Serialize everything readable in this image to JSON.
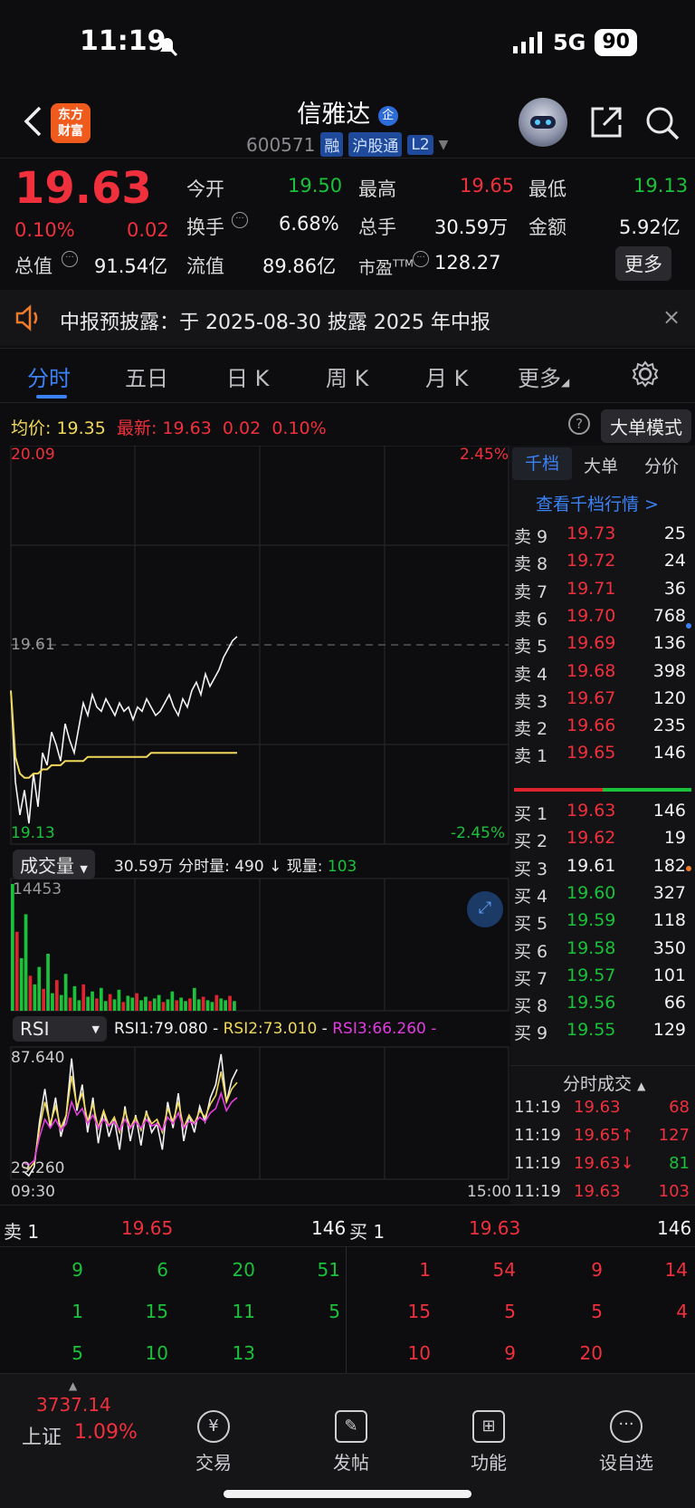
{
  "status": {
    "time": "11:19",
    "signal": "5G",
    "battery": "90"
  },
  "header": {
    "logo": [
      "东方",
      "财富"
    ],
    "name": "信雅达",
    "badge": "企",
    "code": "600571",
    "tags": [
      "融",
      "沪股通",
      "L2"
    ]
  },
  "quote": {
    "price": "19.63",
    "pct": "0.10%",
    "chg": "0.02",
    "open_label": "今开",
    "open": "19.50",
    "high_label": "最高",
    "high": "19.65",
    "low_label": "最低",
    "low": "19.13",
    "turnover_label": "换手",
    "turnover": "6.68%",
    "volume_label": "总手",
    "volume": "30.59万",
    "amount_label": "金额",
    "amount": "5.92亿",
    "mktcap_label": "总值",
    "mktcap": "91.54亿",
    "float_label": "流值",
    "float": "89.86亿",
    "pe_label": "市盈",
    "pe_sup": "TTM",
    "pe": "128.27",
    "more": "更多"
  },
  "notice": {
    "text": "中报预披露：于 2025-08-30 披露 2025 年中报"
  },
  "tabs": [
    "分时",
    "五日",
    "日 K",
    "周 K",
    "月 K",
    "更多"
  ],
  "intraday": {
    "avg_label": "均价:",
    "avg": "19.35",
    "last_label": "最新:",
    "last": "19.63",
    "last_chg": "0.02",
    "last_pct": "0.10%",
    "mode_button": "大单模式",
    "top_price": "20.09",
    "top_pct": "2.45%",
    "ref_price": "19.61",
    "bottom_price": "19.13",
    "bottom_pct": "-2.45%"
  },
  "volume_panel": {
    "selector": "成交量",
    "info_total": "30.59万",
    "info_min_label": "分时量:",
    "info_min": "490",
    "info_now_label": "现量:",
    "info_now": "103",
    "max": "14453"
  },
  "rsi_panel": {
    "selector": "RSI",
    "rsi1_label": "RSI1:",
    "rsi1": "79.080",
    "rsi2_label": "RSI2:",
    "rsi2": "73.010",
    "rsi3_label": "RSI3:",
    "rsi3": "66.260",
    "top": "87.640",
    "bottom": "29.260",
    "time_start": "09:30",
    "time_end": "15:00"
  },
  "orderbook": {
    "tabs": [
      "千档",
      "大单",
      "分价"
    ],
    "link": "查看千档行情 >",
    "asks": [
      {
        "label": "卖 9",
        "price": "19.73",
        "vol": "25"
      },
      {
        "label": "卖 8",
        "price": "19.72",
        "vol": "24"
      },
      {
        "label": "卖 7",
        "price": "19.71",
        "vol": "36"
      },
      {
        "label": "卖 6",
        "price": "19.70",
        "vol": "768"
      },
      {
        "label": "卖 5",
        "price": "19.69",
        "vol": "136"
      },
      {
        "label": "卖 4",
        "price": "19.68",
        "vol": "398"
      },
      {
        "label": "卖 3",
        "price": "19.67",
        "vol": "120"
      },
      {
        "label": "卖 2",
        "price": "19.66",
        "vol": "235"
      },
      {
        "label": "卖 1",
        "price": "19.65",
        "vol": "146"
      }
    ],
    "bids": [
      {
        "label": "买 1",
        "price": "19.63",
        "vol": "146"
      },
      {
        "label": "买 2",
        "price": "19.62",
        "vol": "19"
      },
      {
        "label": "买 3",
        "price": "19.61",
        "vol": "182"
      },
      {
        "label": "买 4",
        "price": "19.60",
        "vol": "327"
      },
      {
        "label": "买 5",
        "price": "19.59",
        "vol": "118"
      },
      {
        "label": "买 6",
        "price": "19.58",
        "vol": "350"
      },
      {
        "label": "买 7",
        "price": "19.57",
        "vol": "101"
      },
      {
        "label": "买 8",
        "price": "19.56",
        "vol": "66"
      },
      {
        "label": "买 9",
        "price": "19.55",
        "vol": "129"
      }
    ],
    "trades_title": "分时成交",
    "trades": [
      {
        "time": "11:19",
        "price": "19.63",
        "vol": "68"
      },
      {
        "time": "11:19",
        "price": "19.65↑",
        "vol": "127"
      },
      {
        "time": "11:19",
        "price": "19.63↓",
        "vol": "81"
      },
      {
        "time": "11:19",
        "price": "19.63",
        "vol": "103"
      }
    ]
  },
  "queue": {
    "sell_label": "卖 1",
    "sell_price": "19.65",
    "sell_vol": "146",
    "buy_label": "买 1",
    "buy_price": "19.63",
    "buy_vol": "146",
    "sell_grid": [
      [
        "9",
        "6",
        "20",
        "51"
      ],
      [
        "1",
        "15",
        "11",
        "5"
      ],
      [
        "5",
        "10",
        "13"
      ]
    ],
    "buy_grid": [
      [
        "1",
        "54",
        "9",
        "14"
      ],
      [
        "15",
        "5",
        "5",
        "4"
      ],
      [
        "10",
        "9",
        "20"
      ]
    ]
  },
  "bottom_nav": {
    "index_value": "3737.14",
    "index_name": "上证",
    "index_pct": "1.09%",
    "items": [
      "交易",
      "发帖",
      "功能",
      "设自选"
    ]
  },
  "chart_data": [
    {
      "type": "line",
      "title": "",
      "xlabel": "",
      "ylabel": "",
      "x_range": [
        "09:30",
        "15:00"
      ],
      "ylim": [
        19.13,
        20.09
      ],
      "series": [
        {
          "values": [
            19.5,
            19.28,
            19.2,
            19.26,
            19.18,
            19.3,
            19.22,
            19.35,
            19.32,
            19.4,
            19.37,
            19.33,
            19.42,
            19.38,
            19.35,
            19.41,
            19.47,
            19.44,
            19.49,
            19.46,
            19.45,
            19.48,
            19.46,
            19.44,
            19.47,
            19.45,
            19.46,
            19.43,
            19.46,
            19.45,
            19.48,
            19.46,
            19.44,
            19.45,
            19.47,
            19.49,
            19.46,
            19.44,
            19.48,
            19.46,
            19.5,
            19.52,
            19.49,
            19.54,
            19.51,
            19.53,
            19.55,
            19.58,
            19.6,
            19.62,
            19.63
          ]
        },
        {
          "values": [
            19.5,
            19.34,
            19.3,
            19.29,
            19.29,
            19.3,
            19.3,
            19.31,
            19.31,
            19.32,
            19.32,
            19.32,
            19.33,
            19.33,
            19.33,
            19.33,
            19.33,
            19.34,
            19.34,
            19.34,
            19.34,
            19.34,
            19.34,
            19.34,
            19.34,
            19.34,
            19.34,
            19.34,
            19.34,
            19.34,
            19.34,
            19.35,
            19.35,
            19.35,
            19.35,
            19.35,
            19.35,
            19.35,
            19.35,
            19.35,
            19.35,
            19.35,
            19.35,
            19.35,
            19.35,
            19.35,
            19.35,
            19.35,
            19.35,
            19.35,
            19.35
          ]
        }
      ]
    },
    {
      "type": "bar",
      "title": "",
      "ylim": [
        0,
        14453
      ],
      "values": [
        14453,
        9000,
        6000,
        11000,
        4000,
        3000,
        5000,
        2500,
        6500,
        2000,
        3500,
        1800,
        4200,
        1500,
        2800,
        1200,
        3000,
        1600,
        2200,
        1400,
        2600,
        1100,
        1900,
        1300,
        2400,
        1000,
        1700,
        1500,
        2000,
        1200,
        1600,
        1100,
        1400,
        1800,
        1000,
        1300,
        2200,
        1200,
        1500,
        1100,
        1400,
        2600,
        1300,
        1600,
        1200,
        1000,
        1800,
        1400,
        1200,
        1700,
        1100
      ]
    },
    {
      "type": "line",
      "title": "",
      "ylim": [
        29.26,
        87.64
      ],
      "series": [
        {
          "name": "RSI1",
          "values": [
            32,
            30,
            34,
            55,
            70,
            52,
            66,
            48,
            58,
            84,
            60,
            72,
            50,
            66,
            45,
            60,
            48,
            56,
            42,
            62,
            46,
            58,
            44,
            60,
            50,
            54,
            42,
            64,
            52,
            68,
            46,
            58,
            50,
            62,
            55,
            66,
            72,
            86,
            64,
            74,
            79
          ]
        },
        {
          "name": "RSI2",
          "values": [
            34,
            33,
            36,
            52,
            64,
            54,
            62,
            52,
            58,
            76,
            62,
            68,
            55,
            63,
            52,
            60,
            53,
            57,
            50,
            60,
            52,
            57,
            51,
            59,
            54,
            56,
            50,
            61,
            55,
            64,
            52,
            58,
            54,
            60,
            57,
            63,
            67,
            78,
            64,
            70,
            73
          ]
        },
        {
          "name": "RSI3",
          "values": [
            36,
            35,
            37,
            48,
            56,
            52,
            56,
            51,
            54,
            64,
            58,
            61,
            54,
            58,
            52,
            56,
            53,
            55,
            51,
            56,
            52,
            55,
            52,
            56,
            53,
            54,
            51,
            57,
            54,
            59,
            52,
            55,
            54,
            57,
            55,
            59,
            61,
            68,
            60,
            64,
            66
          ]
        }
      ]
    }
  ]
}
